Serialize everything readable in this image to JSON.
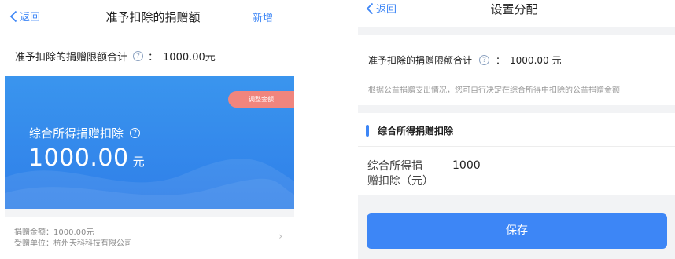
{
  "left": {
    "nav": {
      "back_label": "返回",
      "title": "准予扣除的捐赠额",
      "add_label": "新增"
    },
    "limit_label": "准予扣除的捐赠限额合计",
    "limit_colon": "：",
    "limit_value": "1000.00元",
    "card": {
      "adjust_label": "调整金额",
      "label": "综合所得捐赠扣除",
      "amount": "1000.00",
      "unit": "元"
    },
    "donation_amount": "捐赠金额：1000.00元",
    "recipient": "受赠单位：杭州天科科技有限公司"
  },
  "right": {
    "nav": {
      "back_label": "返回",
      "title": "设置分配"
    },
    "limit_label": "准予扣除的捐赠限额合计",
    "limit_colon": "：",
    "limit_value": "1000.00 元",
    "note": "根据公益捐赠支出情况，您可自行决定在综合所得中扣除的公益捐赠金额",
    "section_title": "综合所得捐赠扣除",
    "field_label": "综合所得捐赠扣除（元）",
    "field_value": "1000",
    "save_label": "保存"
  },
  "colors": {
    "accent": "#3d86f6",
    "card": "#2f7fe9",
    "adjust_button": "#f0857d"
  },
  "icons": {
    "back": "chevron-left-icon",
    "help": "question-circle-icon",
    "arrow": "chevron-right-icon"
  }
}
